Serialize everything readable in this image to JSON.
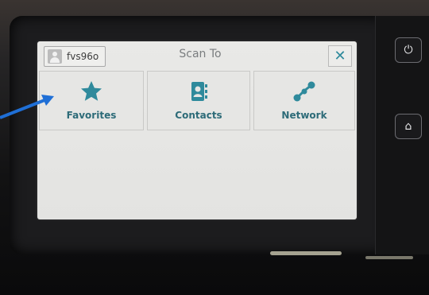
{
  "header": {
    "user": "fvs96o",
    "title": "Scan To",
    "close_glyph": "✕"
  },
  "tiles": [
    {
      "label": "Favorites",
      "icon": "star-icon"
    },
    {
      "label": "Contacts",
      "icon": "address-book-icon"
    },
    {
      "label": "Network",
      "icon": "network-nodes-icon"
    }
  ],
  "hardware": {
    "power_glyph": "⏻",
    "home_glyph": "⌂"
  },
  "colors": {
    "accent": "#2f8a9c",
    "label": "#2d6b78",
    "annotation_arrow": "#1f6fd6"
  }
}
